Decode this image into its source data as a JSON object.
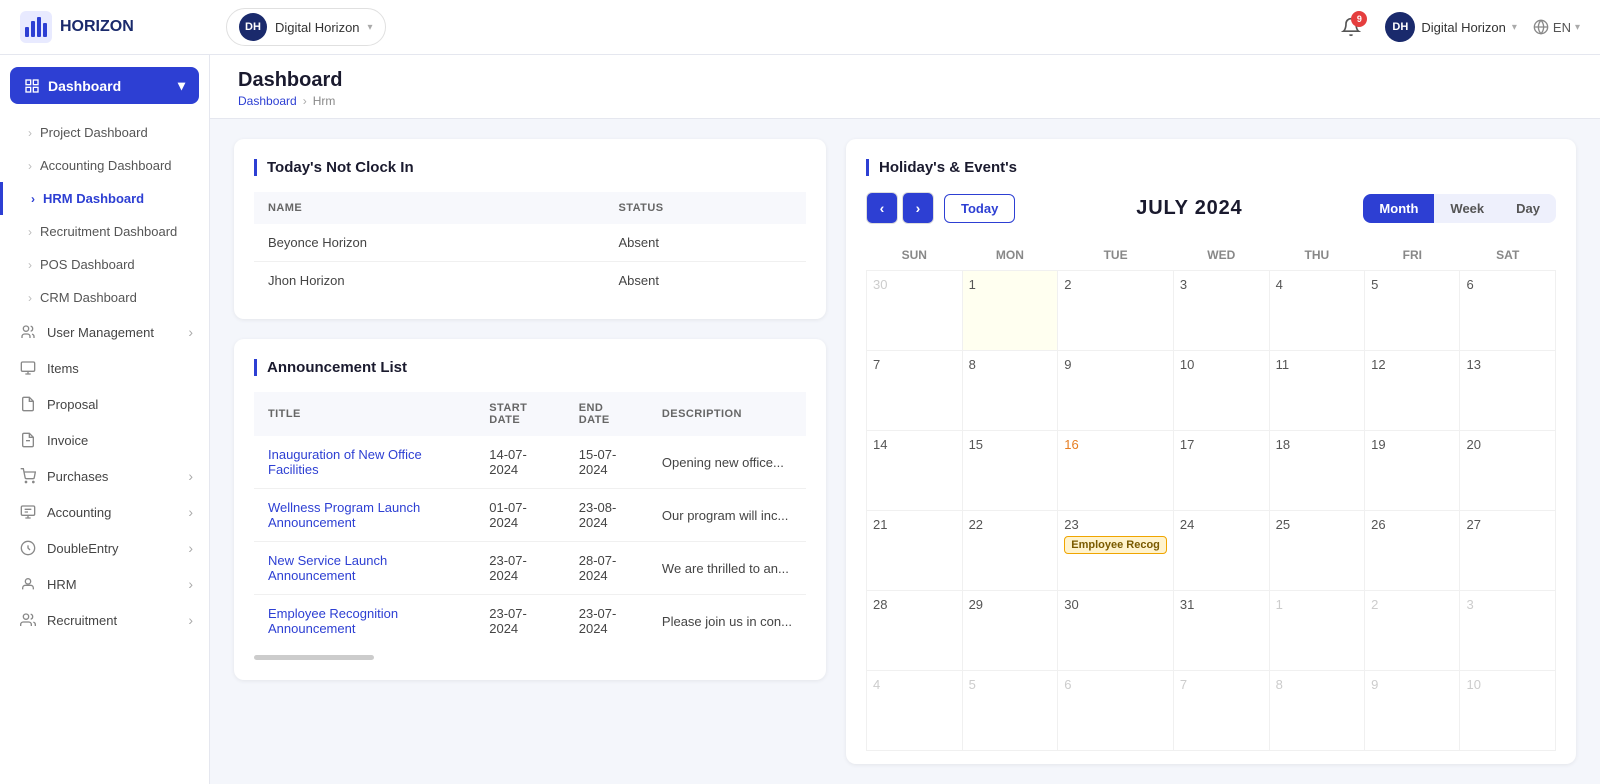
{
  "topnav": {
    "logo_text": "HORIZON",
    "org_name": "Digital Horizon",
    "org_initials": "DH",
    "notification_count": "9",
    "user_label": "Digital Horizon",
    "lang_label": "EN"
  },
  "sidebar": {
    "dashboard_label": "Dashboard",
    "items": [
      {
        "id": "project-dashboard",
        "label": "Project Dashboard",
        "arrow": true,
        "active": false
      },
      {
        "id": "accounting-dashboard",
        "label": "Accounting Dashboard",
        "arrow": true,
        "active": false
      },
      {
        "id": "hrm-dashboard",
        "label": "HRM Dashboard",
        "arrow": false,
        "active": true
      },
      {
        "id": "recruitment-dashboard",
        "label": "Recruitment Dashboard",
        "arrow": true,
        "active": false
      },
      {
        "id": "pos-dashboard",
        "label": "POS Dashboard",
        "arrow": true,
        "active": false
      },
      {
        "id": "crm-dashboard",
        "label": "CRM Dashboard",
        "arrow": true,
        "active": false
      }
    ],
    "nav_items": [
      {
        "id": "user-management",
        "label": "User Management",
        "has_arrow": true
      },
      {
        "id": "items",
        "label": "Items",
        "has_arrow": false
      },
      {
        "id": "proposal",
        "label": "Proposal",
        "has_arrow": false
      },
      {
        "id": "invoice",
        "label": "Invoice",
        "has_arrow": false
      },
      {
        "id": "purchases",
        "label": "Purchases",
        "has_arrow": true
      },
      {
        "id": "accounting",
        "label": "Accounting",
        "has_arrow": true
      },
      {
        "id": "doubleentry",
        "label": "DoubleEntry",
        "has_arrow": true
      },
      {
        "id": "hrm",
        "label": "HRM",
        "has_arrow": true
      },
      {
        "id": "recruitment",
        "label": "Recruitment",
        "has_arrow": true
      }
    ]
  },
  "page": {
    "title": "Dashboard",
    "breadcrumb_link": "Dashboard",
    "breadcrumb_current": "Hrm"
  },
  "not_clock_in": {
    "title": "Today's Not Clock In",
    "columns": [
      "NAME",
      "STATUS"
    ],
    "rows": [
      {
        "name": "Beyonce Horizon",
        "status": "Absent"
      },
      {
        "name": "Jhon Horizon",
        "status": "Absent"
      }
    ]
  },
  "announcement": {
    "title": "Announcement List",
    "columns": [
      "TITLE",
      "START DATE",
      "END DATE",
      "DESCRIPTION"
    ],
    "rows": [
      {
        "title": "Inauguration of New Office Facilities",
        "start": "14-07-2024",
        "end": "15-07-2024",
        "desc": "Opening new office..."
      },
      {
        "title": "Wellness Program Launch Announcement",
        "start": "01-07-2024",
        "end": "23-08-2024",
        "desc": "Our program will inc..."
      },
      {
        "title": "New Service Launch Announcement",
        "start": "23-07-2024",
        "end": "28-07-2024",
        "desc": "We are thrilled to an..."
      },
      {
        "title": "Employee Recognition Announcement",
        "start": "23-07-2024",
        "end": "23-07-2024",
        "desc": "Please join us in con..."
      }
    ]
  },
  "calendar": {
    "title": "Holiday's & Event's",
    "month_label": "JULY 2024",
    "today_btn": "Today",
    "view_month": "Month",
    "view_week": "Week",
    "view_day": "Day",
    "days_of_week": [
      "Sun",
      "Mon",
      "Tue",
      "Wed",
      "Thu",
      "Fri",
      "Sat"
    ],
    "weeks": [
      [
        {
          "num": "30",
          "other": true,
          "today": false
        },
        {
          "num": "1",
          "other": false,
          "today": true
        },
        {
          "num": "2",
          "other": false,
          "today": false
        },
        {
          "num": "3",
          "other": false,
          "today": false
        },
        {
          "num": "4",
          "other": false,
          "today": false
        },
        {
          "num": "5",
          "other": false,
          "today": false
        },
        {
          "num": "6",
          "other": false,
          "today": false
        }
      ],
      [
        {
          "num": "7",
          "other": false,
          "today": false
        },
        {
          "num": "8",
          "other": false,
          "today": false
        },
        {
          "num": "9",
          "other": false,
          "today": false
        },
        {
          "num": "10",
          "other": false,
          "today": false
        },
        {
          "num": "11",
          "other": false,
          "today": false
        },
        {
          "num": "12",
          "other": false,
          "today": false
        },
        {
          "num": "13",
          "other": false,
          "today": false
        }
      ],
      [
        {
          "num": "14",
          "other": false,
          "today": false
        },
        {
          "num": "15",
          "other": false,
          "today": false
        },
        {
          "num": "16",
          "other": false,
          "today": false,
          "orange": true
        },
        {
          "num": "17",
          "other": false,
          "today": false
        },
        {
          "num": "18",
          "other": false,
          "today": false
        },
        {
          "num": "19",
          "other": false,
          "today": false
        },
        {
          "num": "20",
          "other": false,
          "today": false
        }
      ],
      [
        {
          "num": "21",
          "other": false,
          "today": false
        },
        {
          "num": "22",
          "other": false,
          "today": false
        },
        {
          "num": "23",
          "other": false,
          "today": false,
          "event": "Employee Recog"
        },
        {
          "num": "24",
          "other": false,
          "today": false
        },
        {
          "num": "25",
          "other": false,
          "today": false
        },
        {
          "num": "26",
          "other": false,
          "today": false
        },
        {
          "num": "27",
          "other": false,
          "today": false
        }
      ],
      [
        {
          "num": "28",
          "other": false,
          "today": false
        },
        {
          "num": "29",
          "other": false,
          "today": false
        },
        {
          "num": "30",
          "other": false,
          "today": false
        },
        {
          "num": "31",
          "other": false,
          "today": false
        },
        {
          "num": "1",
          "other": true,
          "today": false
        },
        {
          "num": "2",
          "other": true,
          "today": false
        },
        {
          "num": "3",
          "other": true,
          "today": false
        }
      ],
      [
        {
          "num": "4",
          "other": true,
          "today": false
        },
        {
          "num": "5",
          "other": true,
          "today": false
        },
        {
          "num": "6",
          "other": true,
          "today": false
        },
        {
          "num": "7",
          "other": true,
          "today": false
        },
        {
          "num": "8",
          "other": true,
          "today": false
        },
        {
          "num": "9",
          "other": true,
          "today": false
        },
        {
          "num": "10",
          "other": true,
          "today": false
        }
      ]
    ]
  }
}
